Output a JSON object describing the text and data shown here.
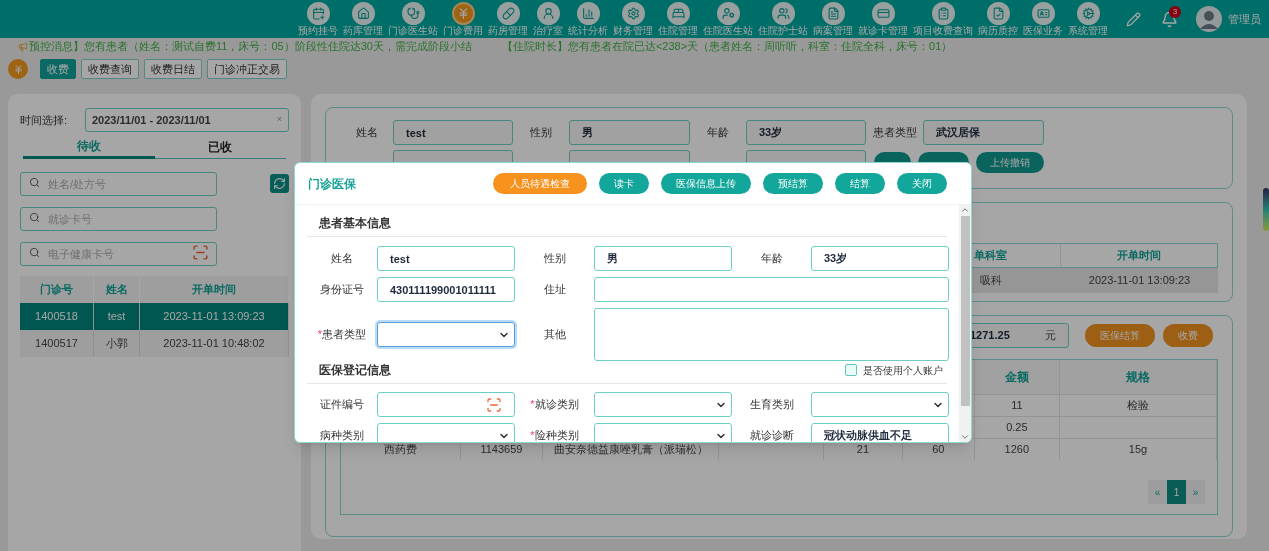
{
  "nav": {
    "items": [
      {
        "label": "预约挂号",
        "selected": false
      },
      {
        "label": "药库管理",
        "selected": false
      },
      {
        "label": "门诊医生站",
        "selected": false
      },
      {
        "label": "门诊费用",
        "selected": true
      },
      {
        "label": "药房管理",
        "selected": false
      },
      {
        "label": "治疗室",
        "selected": false
      },
      {
        "label": "统计分析",
        "selected": false
      },
      {
        "label": "财务管理",
        "selected": false
      },
      {
        "label": "住院管理",
        "selected": false
      },
      {
        "label": "住院医生站",
        "selected": false
      },
      {
        "label": "住院护士站",
        "selected": false
      },
      {
        "label": "病案管理",
        "selected": false
      },
      {
        "label": "就诊卡管理",
        "selected": false
      },
      {
        "label": "项目收费查询",
        "selected": false
      },
      {
        "label": "病历质控",
        "selected": false
      },
      {
        "label": "医保业务",
        "selected": false
      },
      {
        "label": "系统管理",
        "selected": false
      }
    ],
    "badge": "3",
    "user": "管理员"
  },
  "notices": [
    "预控消息】您有患者（姓名：测试自费11，床号：05）阶段性住院达30天，需完成阶段小结",
    "【住院时长】您有患者在院已达<238>天（患者姓名：周听听，科室：住院全科，床号：01）"
  ],
  "tabs": [
    {
      "label": "收费",
      "selected": true
    },
    {
      "label": "收费查询",
      "selected": false
    },
    {
      "label": "收费日结",
      "selected": false
    },
    {
      "label": "门诊冲正交易",
      "selected": false
    }
  ],
  "left": {
    "date_label": "时间选择:",
    "date_range": "2023/11/01 - 2023/11/01",
    "clear": "×",
    "tabs": [
      {
        "label": "待收",
        "selected": true
      },
      {
        "label": "已收",
        "selected": false
      }
    ],
    "searches": [
      {
        "placeholder": "姓名/处方号",
        "scan": false
      },
      {
        "placeholder": "就诊卡号",
        "scan": false
      },
      {
        "placeholder": "电子健康卡号",
        "scan": true
      }
    ],
    "table": {
      "columns": [
        "门诊号",
        "姓名",
        "开单时间"
      ],
      "rows": [
        {
          "cells": [
            "1400518",
            "test",
            "2023-11-01 13:09:23"
          ],
          "selected": true
        },
        {
          "cells": [
            "1400517",
            "小郭",
            "2023-11-01 10:48:02"
          ],
          "selected": false
        }
      ]
    }
  },
  "patient": {
    "fields": [
      {
        "label": "姓名",
        "value": "test"
      },
      {
        "label": "性别",
        "value": "男"
      },
      {
        "label": "年龄",
        "value": "33岁"
      },
      {
        "label": "患者类型",
        "value": "武汉居保"
      }
    ],
    "buttons": [
      "上传撤销"
    ]
  },
  "orders": {
    "columns": [
      "单科室",
      "开单时间"
    ],
    "rows": [
      {
        "cells": [
          "吸科",
          "2023-11-01 13:09:23"
        ],
        "selected": true
      }
    ]
  },
  "fees": {
    "total": "1271.25",
    "unit": "元",
    "buttons": [
      "医保结算",
      "收费"
    ],
    "columns": {
      "amount": "金额",
      "spec": "规格"
    },
    "rows": [
      {
        "amount": "11",
        "spec": "检验"
      },
      {
        "amount": "0.25"
      },
      {
        "column_1": "西药费",
        "column_2": "1143659",
        "column_3": "曲安奈德益康唑乳膏（派瑞松）",
        "column_5": "21",
        "column_6": "60",
        "amount": "1260",
        "spec": "15g"
      }
    ],
    "pagination": {
      "prev": "«",
      "pages": [
        {
          "label": "1",
          "selected": true
        }
      ],
      "next": "»"
    }
  },
  "modal": {
    "title": "门诊医保",
    "required_mark": "*",
    "buttons": [
      {
        "label": "人员待遇检查",
        "kind": "warning"
      },
      {
        "label": "读卡",
        "kind": "primary"
      },
      {
        "label": "医保信息上传",
        "kind": "primary"
      },
      {
        "label": "预结算",
        "kind": "primary"
      },
      {
        "label": "结算",
        "kind": "primary"
      },
      {
        "label": "关闭",
        "kind": "primary"
      }
    ],
    "sections": [
      {
        "title": "患者基本信息",
        "fields": [
          {
            "label": "姓名",
            "kind": "text",
            "value": "test",
            "required": false,
            "focused": false
          },
          {
            "label": "性别",
            "kind": "text",
            "value": "男",
            "required": false,
            "focused": false
          },
          {
            "label": "年龄",
            "kind": "text",
            "value": "33岁",
            "required": false,
            "focused": false
          },
          {
            "label": "身份证号",
            "kind": "text",
            "value": "430111199001011111",
            "required": false,
            "focused": false
          },
          {
            "label": "住址",
            "kind": "wide",
            "required": false,
            "focused": false
          },
          {
            "label": "患者类型",
            "kind": "select",
            "required": true,
            "focused": true
          },
          {
            "label": "其他",
            "kind": "textarea",
            "required": false,
            "focused": false
          }
        ]
      },
      {
        "title": "医保登记信息",
        "checkbox": {
          "label": "是否使用个人账户",
          "checked": false
        },
        "fields": [
          {
            "label": "证件编号",
            "kind": "scan",
            "required": false,
            "focused": false
          },
          {
            "label": "就诊类别",
            "kind": "select",
            "required": true,
            "focused": false
          },
          {
            "label": "生育类别",
            "kind": "select",
            "required": false,
            "focused": false
          },
          {
            "label": "病种类别",
            "kind": "select",
            "required": false,
            "focused": false
          },
          {
            "label": "险种类别",
            "kind": "select",
            "required": true,
            "focused": false
          },
          {
            "label": "就诊诊断",
            "kind": "text",
            "value": "冠状动脉供血不足",
            "required": false,
            "focused": false
          }
        ]
      }
    ]
  }
}
